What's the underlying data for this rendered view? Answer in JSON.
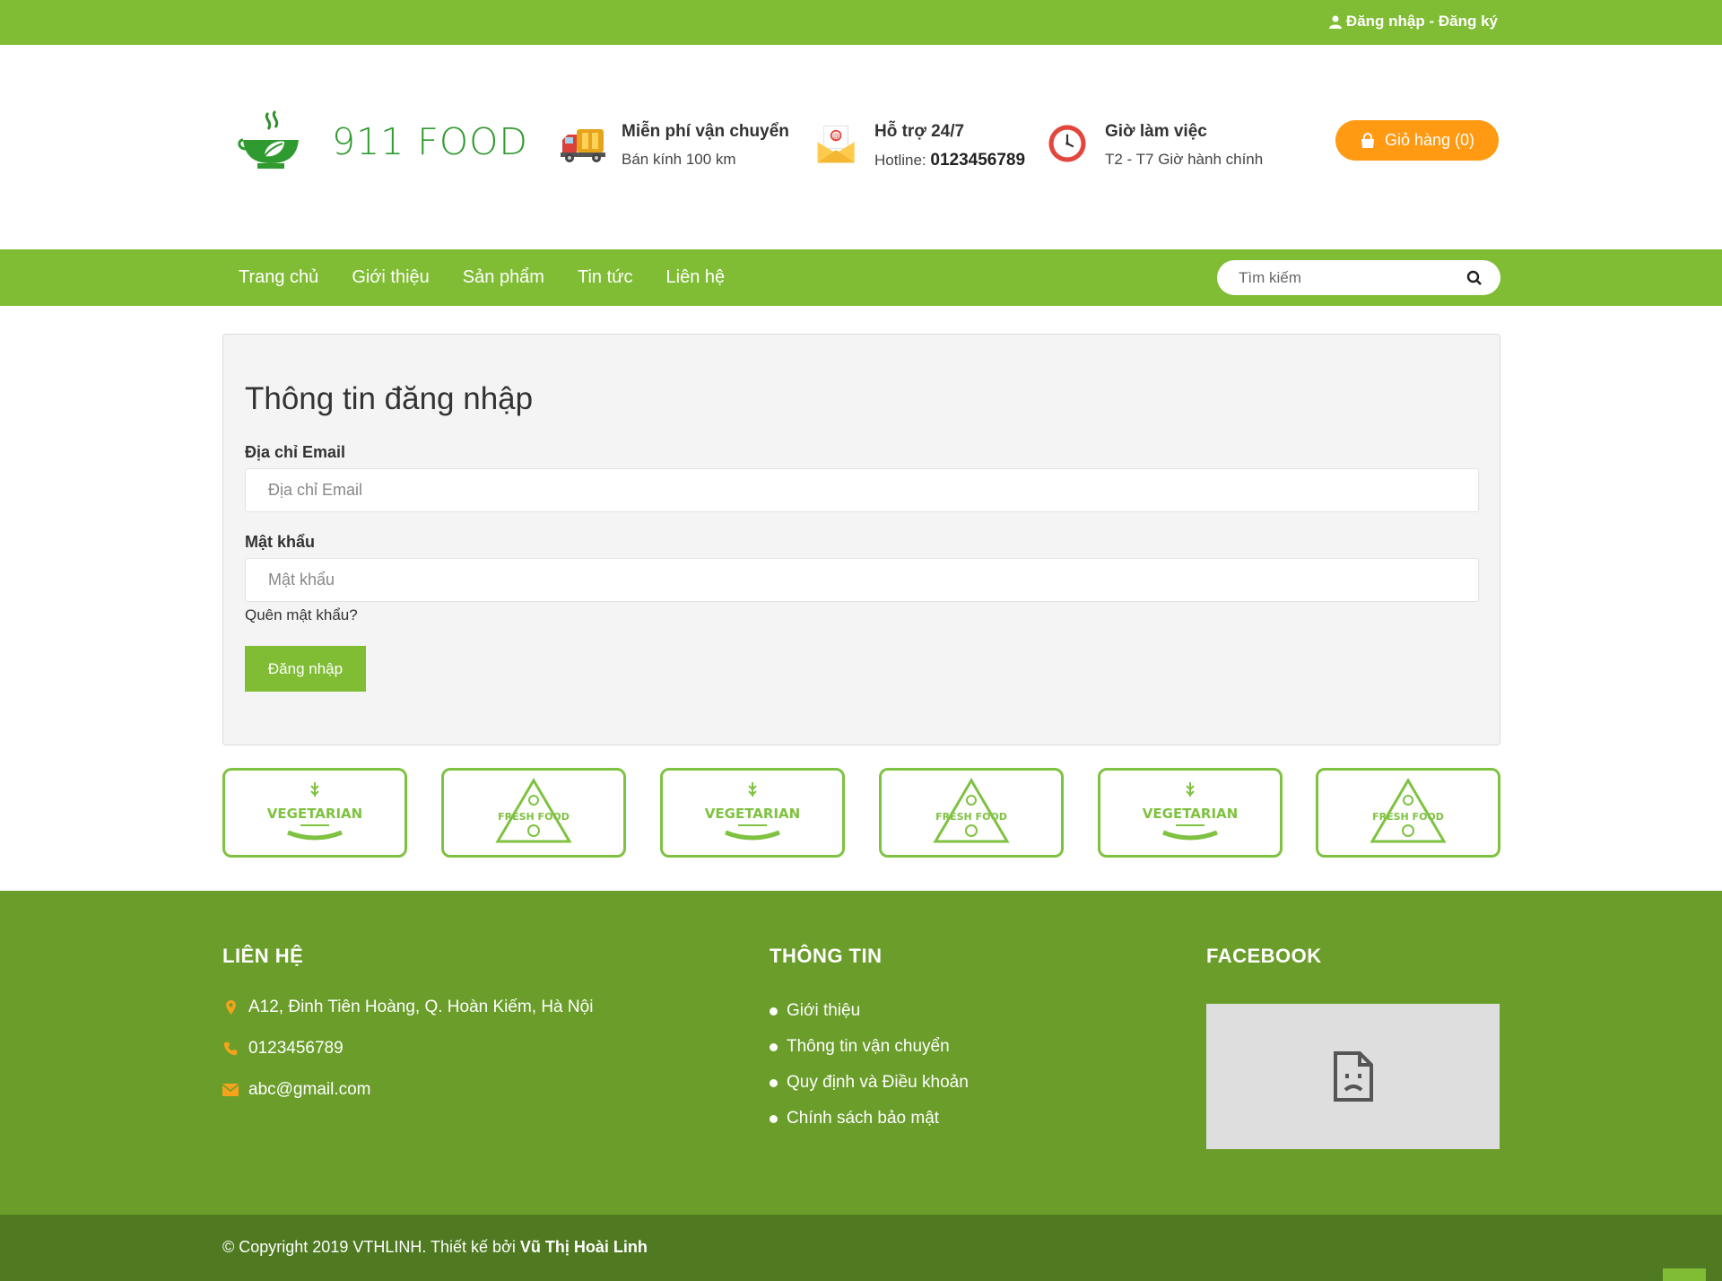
{
  "topbar": {
    "auth_text": "Đăng nhập - Đăng ký"
  },
  "header": {
    "logo_text": "911 FOOD",
    "info": [
      {
        "title": "Miễn phí vận chuyển",
        "sub": "Bán kính 100 km"
      },
      {
        "title": "Hỗ trợ 24/7",
        "sub_prefix": "Hotline: ",
        "sub_strong": "0123456789"
      },
      {
        "title": "Giờ làm việc",
        "sub_strong": "T2 - T7",
        "sub_suffix": " Giờ hành chính"
      }
    ],
    "cart_label": "Giỏ hàng (0)"
  },
  "nav": {
    "items": [
      "Trang chủ",
      "Giới thiệu",
      "Sản phẩm",
      "Tin tức",
      "Liên hệ"
    ],
    "search_placeholder": "Tìm kiếm"
  },
  "login": {
    "heading": "Thông tin đăng nhập",
    "email_label": "Địa chỉ Email",
    "email_placeholder": "Địa chỉ Email",
    "email_value": "",
    "password_label": "Mật khẩu",
    "password_placeholder": "Mật khẩu",
    "password_value": "",
    "forgot_link": "Quên mật khẩu?",
    "submit_label": "Đăng nhập"
  },
  "brands": [
    "VEGETARIAN",
    "FRESH FOOD",
    "VEGETARIAN",
    "FRESH FOOD",
    "VEGETARIAN",
    "FRESH FOOD"
  ],
  "footer": {
    "contact": {
      "title": "LIÊN HỆ",
      "address": "A12, Đinh Tiên Hoàng, Q. Hoàn Kiếm, Hà Nội",
      "phone": "0123456789",
      "email": "abc@gmail.com"
    },
    "info": {
      "title": "THÔNG TIN",
      "links": [
        "Giới thiệu",
        "Thông tin vận chuyển",
        "Quy định và Điều khoản",
        "Chính sách bảo mật"
      ]
    },
    "facebook": {
      "title": "FACEBOOK"
    },
    "copyright_prefix": "© Copyright 2019 VTHLINH. Thiết kế bởi ",
    "copyright_author": "Vũ Thị Hoài Linh"
  },
  "colors": {
    "brand_green": "#80bd35",
    "footer_green": "#6b9d2b",
    "copyright_green": "#507a21",
    "cart_orange": "#ff9a12",
    "icon_orange": "#f7a21b"
  }
}
